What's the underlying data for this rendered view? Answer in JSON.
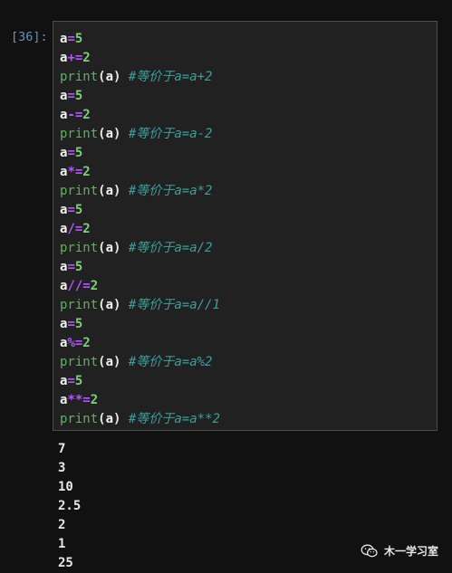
{
  "cell": {
    "prompt": "[36]:",
    "lines": [
      [
        {
          "t": "a",
          "c": "var"
        },
        {
          "t": "=",
          "c": "op"
        },
        {
          "t": "5",
          "c": "num"
        }
      ],
      [
        {
          "t": "a",
          "c": "var"
        },
        {
          "t": "+=",
          "c": "op"
        },
        {
          "t": "2",
          "c": "num"
        }
      ],
      [
        {
          "t": "print",
          "c": "kw"
        },
        {
          "t": "(",
          "c": "paren"
        },
        {
          "t": "a",
          "c": "var"
        },
        {
          "t": ")",
          "c": "paren"
        },
        {
          "t": " ",
          "c": "var"
        },
        {
          "t": "#等价于a=a+2",
          "c": "comment"
        }
      ],
      [
        {
          "t": "a",
          "c": "var"
        },
        {
          "t": "=",
          "c": "op"
        },
        {
          "t": "5",
          "c": "num"
        }
      ],
      [
        {
          "t": "a",
          "c": "var"
        },
        {
          "t": "-=",
          "c": "op"
        },
        {
          "t": "2",
          "c": "num"
        }
      ],
      [
        {
          "t": "print",
          "c": "kw"
        },
        {
          "t": "(",
          "c": "paren"
        },
        {
          "t": "a",
          "c": "var"
        },
        {
          "t": ")",
          "c": "paren"
        },
        {
          "t": " ",
          "c": "var"
        },
        {
          "t": "#等价于a=a-2",
          "c": "comment"
        }
      ],
      [
        {
          "t": "a",
          "c": "var"
        },
        {
          "t": "=",
          "c": "op"
        },
        {
          "t": "5",
          "c": "num"
        }
      ],
      [
        {
          "t": "a",
          "c": "var"
        },
        {
          "t": "*=",
          "c": "op"
        },
        {
          "t": "2",
          "c": "num"
        }
      ],
      [
        {
          "t": "print",
          "c": "kw"
        },
        {
          "t": "(",
          "c": "paren"
        },
        {
          "t": "a",
          "c": "var"
        },
        {
          "t": ")",
          "c": "paren"
        },
        {
          "t": " ",
          "c": "var"
        },
        {
          "t": "#等价于a=a*2",
          "c": "comment"
        }
      ],
      [
        {
          "t": "a",
          "c": "var"
        },
        {
          "t": "=",
          "c": "op"
        },
        {
          "t": "5",
          "c": "num"
        }
      ],
      [
        {
          "t": "a",
          "c": "var"
        },
        {
          "t": "/=",
          "c": "op"
        },
        {
          "t": "2",
          "c": "num"
        }
      ],
      [
        {
          "t": "print",
          "c": "kw"
        },
        {
          "t": "(",
          "c": "paren"
        },
        {
          "t": "a",
          "c": "var"
        },
        {
          "t": ")",
          "c": "paren"
        },
        {
          "t": " ",
          "c": "var"
        },
        {
          "t": "#等价于a=a/2",
          "c": "comment"
        }
      ],
      [
        {
          "t": "a",
          "c": "var"
        },
        {
          "t": "=",
          "c": "op"
        },
        {
          "t": "5",
          "c": "num"
        }
      ],
      [
        {
          "t": "a",
          "c": "var"
        },
        {
          "t": "//=",
          "c": "op"
        },
        {
          "t": "2",
          "c": "num"
        }
      ],
      [
        {
          "t": "print",
          "c": "kw"
        },
        {
          "t": "(",
          "c": "paren"
        },
        {
          "t": "a",
          "c": "var"
        },
        {
          "t": ")",
          "c": "paren"
        },
        {
          "t": " ",
          "c": "var"
        },
        {
          "t": "#等价于a=a//1",
          "c": "comment"
        }
      ],
      [
        {
          "t": "a",
          "c": "var"
        },
        {
          "t": "=",
          "c": "op"
        },
        {
          "t": "5",
          "c": "num"
        }
      ],
      [
        {
          "t": "a",
          "c": "var"
        },
        {
          "t": "%=",
          "c": "op"
        },
        {
          "t": "2",
          "c": "num"
        }
      ],
      [
        {
          "t": "print",
          "c": "kw"
        },
        {
          "t": "(",
          "c": "paren"
        },
        {
          "t": "a",
          "c": "var"
        },
        {
          "t": ")",
          "c": "paren"
        },
        {
          "t": " ",
          "c": "var"
        },
        {
          "t": "#等价于a=a%2",
          "c": "comment"
        }
      ],
      [
        {
          "t": "a",
          "c": "var"
        },
        {
          "t": "=",
          "c": "op"
        },
        {
          "t": "5",
          "c": "num"
        }
      ],
      [
        {
          "t": "a",
          "c": "var"
        },
        {
          "t": "**=",
          "c": "op"
        },
        {
          "t": "2",
          "c": "num"
        }
      ],
      [
        {
          "t": "print",
          "c": "kw"
        },
        {
          "t": "(",
          "c": "paren"
        },
        {
          "t": "a",
          "c": "var"
        },
        {
          "t": ")",
          "c": "paren"
        },
        {
          "t": " ",
          "c": "var"
        },
        {
          "t": "#等价于a=a**2",
          "c": "comment"
        }
      ]
    ]
  },
  "output": [
    "7",
    "3",
    "10",
    "2.5",
    "2",
    "1",
    "25"
  ],
  "watermark": {
    "icon": "wechat-icon",
    "text": "木一学习室"
  },
  "colors": {
    "background": "#111111",
    "cell_background": "#212121",
    "cell_border": "#4d4d4d",
    "prompt": "#6f8fb8",
    "operator": "#b455ff",
    "number": "#7ed07e",
    "keyword": "#60b060",
    "comment": "#3e9e9e"
  }
}
